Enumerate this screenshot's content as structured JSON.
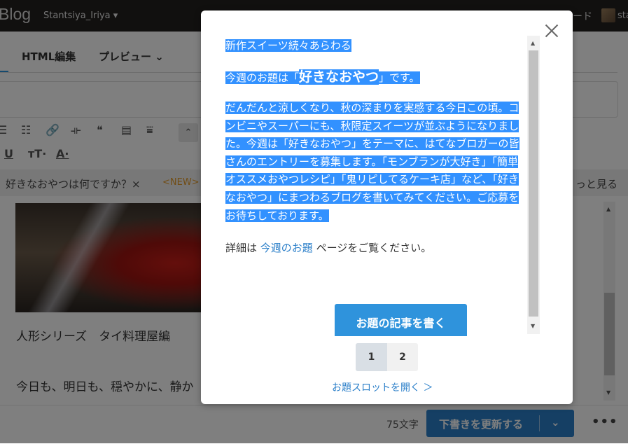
{
  "topbar": {
    "logo": "Blog",
    "user_menu": "Stantsiya_Iriya ▾",
    "right_text": "ード",
    "right_user": "sta"
  },
  "editor": {
    "tab_html": "HTML編集",
    "tab_preview": "プレビュー ⌄",
    "toolbar_row1": [
      "☰",
      "☷",
      "🔗",
      "⟛",
      "❝",
      "▤",
      "⩸"
    ],
    "toolbar_row2": [
      "U",
      "тT·",
      "A·"
    ],
    "collapse_icon": "⌃",
    "suggest_text": "好きなおやつは何ですか？×",
    "suggest_new": "<NEW>",
    "suggest_more": "っと見る",
    "post_title": "人形シリーズ　タイ料理屋編",
    "post_body": "今日も、明日も、穏やかに、静か",
    "char_count": "75文字",
    "save_label": "下書きを更新する",
    "save_chevron": "⌄",
    "more_label": "•••"
  },
  "modal": {
    "heading": "新作スイーツ続々あらわる",
    "topic_prefix": "今週のお題は「",
    "topic_emph": "好きなおやつ",
    "topic_suffix": "」です。",
    "body": "だんだんと涼しくなり、秋の深まりを実感する今日この頃。コンビニやスーパーにも、秋限定スイーツが並ぶようになりました。今週は「好きなおやつ」をテーマに、はてなブロガーの皆さんのエントリーを募集します。「モンブランが大好き」「簡単オススメおやつレシピ」「鬼リピしてるケーキ店」など、「好きなおやつ」にまつわるブログを書いてみてください。ご応募をお待ちしております。",
    "detail_prefix": "詳細は ",
    "detail_link": "今週のお題",
    "detail_suffix": " ページをご覧ください。",
    "cta": "お題の記事を書く",
    "pages": [
      "1",
      "2"
    ],
    "slot_link": "お題スロットを開く ＞"
  },
  "colors": {
    "accent": "#2b7fc9",
    "highlight": "#3291ff",
    "topbar": "#23211f"
  }
}
